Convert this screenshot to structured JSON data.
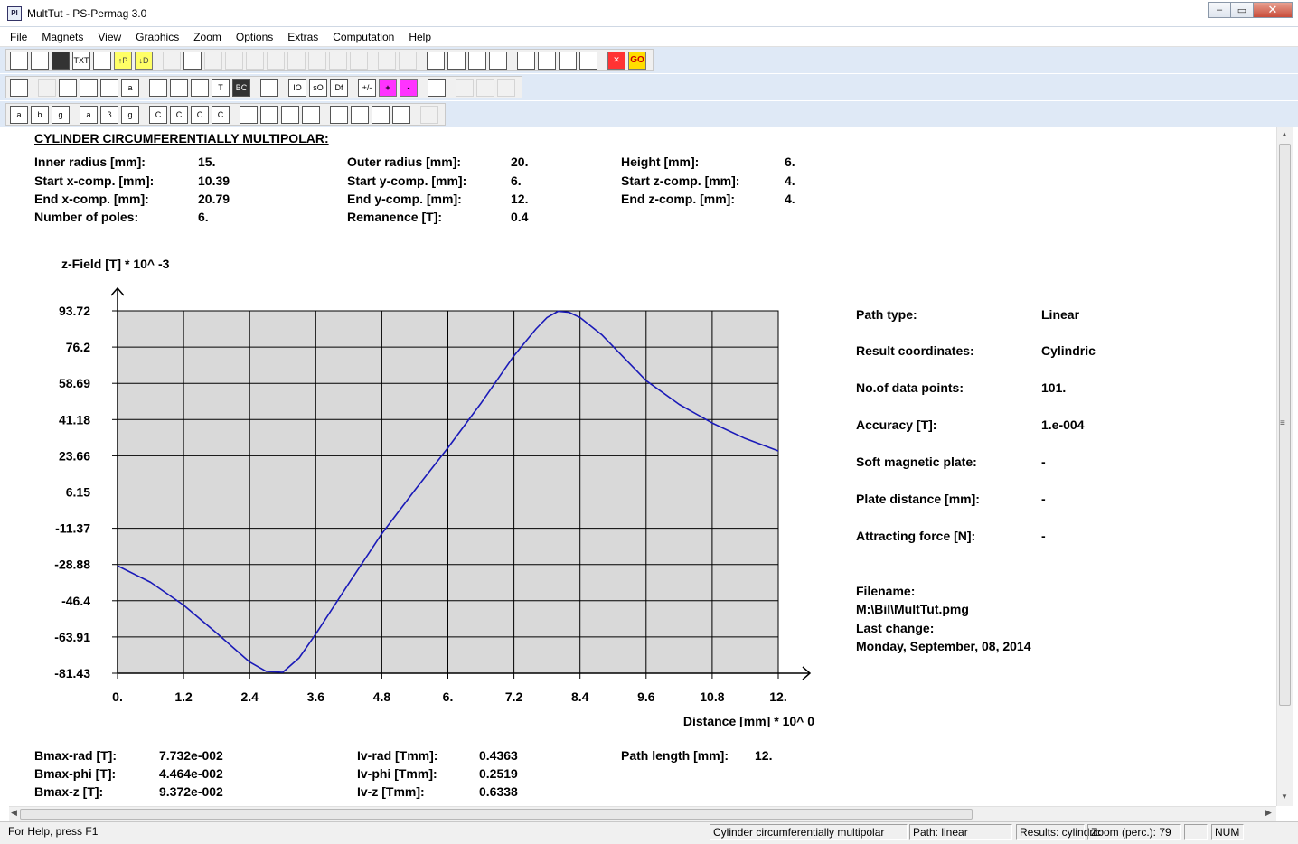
{
  "window": {
    "title": "MultTut - PS-Permag 3.0",
    "icon": "permag-app-icon",
    "icon_text": "PI"
  },
  "window_buttons": {
    "minimize": "–",
    "restore": "▭",
    "close": "✕"
  },
  "menu": [
    "File",
    "Magnets",
    "View",
    "Graphics",
    "Zoom",
    "Options",
    "Extras",
    "Computation",
    "Help"
  ],
  "toolbar1": [
    "",
    "",
    "",
    "TXT",
    "",
    "↑P",
    "↓D",
    "",
    "",
    "",
    "",
    "",
    "",
    "",
    "",
    "",
    "",
    "",
    "",
    "",
    "",
    "",
    "",
    "",
    "",
    "",
    "",
    "✕",
    "GO"
  ],
  "toolbar2": [
    "",
    "",
    "",
    "",
    "",
    "a",
    "",
    "",
    "",
    "T",
    "BC",
    "",
    "IO",
    "sO",
    "Df",
    "+/-",
    "+",
    "-",
    "",
    "",
    "",
    ""
  ],
  "toolbar3": [
    "a",
    "b",
    "g",
    "a",
    "β",
    "g",
    "C",
    "C",
    "C",
    "C",
    "",
    "",
    "",
    "",
    "",
    "",
    "",
    "",
    ""
  ],
  "doc": {
    "heading": "CYLINDER CIRCUMFERENTIALLY MULTIPOLAR:",
    "params": [
      {
        "label": "Inner radius [mm]:",
        "value": "15."
      },
      {
        "label": "Start x-comp. [mm]:",
        "value": "10.39"
      },
      {
        "label": "End x-comp. [mm]:",
        "value": "20.79"
      },
      {
        "label": "Number of poles:",
        "value": "6."
      },
      {
        "label": "Outer radius [mm]:",
        "value": "20."
      },
      {
        "label": "Start y-comp. [mm]:",
        "value": "6."
      },
      {
        "label": "End y-comp. [mm]:",
        "value": "12."
      },
      {
        "label": "Remanence [T]:",
        "value": "0.4"
      },
      {
        "label": "Height [mm]:",
        "value": "6."
      },
      {
        "label": "Start z-comp. [mm]:",
        "value": "4."
      },
      {
        "label": "End z-comp. [mm]:",
        "value": "4."
      }
    ],
    "info": [
      {
        "label": "Path type:",
        "value": "Linear"
      },
      {
        "label": "Result coordinates:",
        "value": "Cylindric"
      },
      {
        "label": "No.of data points:",
        "value": "101."
      },
      {
        "label": "Accuracy [T]:",
        "value": "1.e-004"
      },
      {
        "label": "Soft magnetic plate:",
        "value": "-"
      },
      {
        "label": "Plate distance [mm]:",
        "value": "-"
      },
      {
        "label": "Attracting force [N]:",
        "value": "-"
      }
    ],
    "file": {
      "filename_label": "Filename:",
      "filename": "M:\\Bil\\MultTut.pmg",
      "lastchange_label": "Last change:",
      "lastchange": "Monday, September, 08, 2014"
    },
    "results": [
      {
        "label": "Bmax-rad [T]:",
        "value": "7.732e-002"
      },
      {
        "label": "Bmax-phi [T]:",
        "value": "4.464e-002"
      },
      {
        "label": "Bmax-z [T]:",
        "value": "9.372e-002"
      },
      {
        "label": "Iv-rad [Tmm]:",
        "value": "0.4363"
      },
      {
        "label": "Iv-phi [Tmm]:",
        "value": "0.2519"
      },
      {
        "label": "Iv-z [Tmm]:",
        "value": "0.6338"
      },
      {
        "label": "Path length [mm]:",
        "value": "12."
      }
    ]
  },
  "chart_data": {
    "type": "line",
    "title": "",
    "ylabel": "z-Field [T] * 10^ -3",
    "xlabel": "Distance [mm] * 10^ 0",
    "xlim": [
      0,
      12
    ],
    "ylim": [
      -81.43,
      93.72
    ],
    "x_ticks": [
      "0.",
      "1.2",
      "2.4",
      "3.6",
      "4.8",
      "6.",
      "7.2",
      "8.4",
      "9.6",
      "10.8",
      "12."
    ],
    "y_ticks": [
      "93.72",
      "76.2",
      "58.69",
      "41.18",
      "23.66",
      "6.15",
      "-11.37",
      "-28.88",
      "-46.4",
      "-63.91",
      "-81.43"
    ],
    "grid": true,
    "line_color": "#1a1ab8",
    "plot_background": "#d9d9d9",
    "series": [
      {
        "x": [
          0,
          0.6,
          1.2,
          1.8,
          2.4,
          2.7,
          3.0,
          3.3,
          3.6,
          4.2,
          4.8,
          5.4,
          6.0,
          6.6,
          7.2,
          7.6,
          7.8,
          8.0,
          8.2,
          8.4,
          8.8,
          9.6,
          10.2,
          10.8,
          11.4,
          12.0
        ],
        "y": [
          -29.5,
          -37.5,
          -48.5,
          -62.0,
          -76.0,
          -80.5,
          -81.0,
          -74.0,
          -62.5,
          -38.0,
          -14.0,
          7.0,
          27.5,
          49.0,
          72.0,
          85.0,
          90.5,
          93.5,
          93.0,
          90.5,
          82.0,
          60.0,
          48.5,
          39.5,
          32.0,
          26.0
        ]
      }
    ]
  },
  "scroll": {
    "up": "▲",
    "down": "▼",
    "left": "◀",
    "right": "▶",
    "grip": "≡"
  },
  "status": {
    "help": "For Help, press F1",
    "magnet": "Cylinder circumferentially multipolar",
    "path": "Path: linear",
    "results": "Results: cylindric",
    "zoom": "Zoom (perc.): 79",
    "blank": "",
    "num": "NUM"
  }
}
